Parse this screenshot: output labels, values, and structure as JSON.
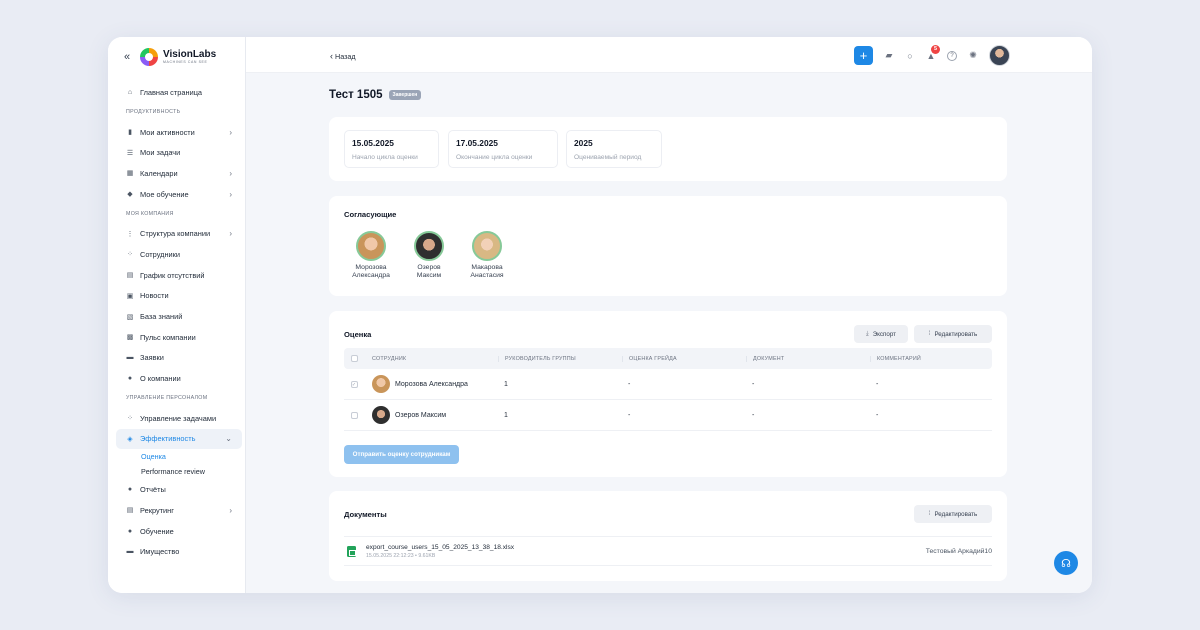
{
  "brand": {
    "name": "VisionLabs",
    "tagline": "MACHINES CAN SEE"
  },
  "colors": {
    "accent": "#1e88e5",
    "sidebar_active_bg": "#eef2f8",
    "badge": "#ef4444",
    "status_tag": "#9aa4b6"
  },
  "sidebar": {
    "home": "Главная страница",
    "sec_productivity": "ПРОДУКТИВНОСТЬ",
    "my_activities": "Мои активности",
    "my_tasks": "Мои задачи",
    "calendars": "Календари",
    "my_learning": "Мое обучение",
    "sec_company": "МОЯ КОМПАНИЯ",
    "company_structure": "Структура компании",
    "employees": "Сотрудники",
    "absence_schedule": "График отсутствий",
    "news": "Новости",
    "knowledge_base": "База знаний",
    "company_pulse": "Пульс компании",
    "requests": "Заявки",
    "about_company": "О компании",
    "sec_hr": "УПРАВЛЕНИЕ ПЕРСОНАЛОМ",
    "task_management": "Управление задачами",
    "efficiency": "Эффективность",
    "sub_assessment": "Оценка",
    "sub_performance_review": "Performance review",
    "reports": "Отчёты",
    "recruiting": "Рекрутинг",
    "training": "Обучение",
    "property": "Имущество"
  },
  "header": {
    "back_label": "Назад",
    "notifications_count": "5"
  },
  "page": {
    "title": "Тест 1505",
    "status": "Завершен"
  },
  "period": [
    {
      "value": "15.05.2025",
      "label": "Начало цикла оценки"
    },
    {
      "value": "17.05.2025",
      "label": "Окончание цикла оценки"
    },
    {
      "value": "2025",
      "label": "Оцениваемый период"
    }
  ],
  "approvers": {
    "title": "Согласующие",
    "people": [
      {
        "line1": "Морозова",
        "line2": "Александра"
      },
      {
        "line1": "Озеров",
        "line2": "Максим"
      },
      {
        "line1": "Макарова",
        "line2": "Анастасия"
      }
    ]
  },
  "assessment": {
    "title": "Оценка",
    "export_label": "Экспорт",
    "edit_label": "Редактировать",
    "columns": [
      "СОТРУДНИК",
      "РУКОВОДИТЕЛЬ ГРУППЫ",
      "ОЦЕНКА ГРЕЙДА",
      "ДОКУМЕНТ",
      "КОММЕНТАРИЙ"
    ],
    "rows": [
      {
        "employee": "Морозова Александра",
        "lead": "1",
        "grade": "-",
        "document": "-",
        "comment": "-",
        "checked": true
      },
      {
        "employee": "Озеров Максим",
        "lead": "1",
        "grade": "-",
        "document": "-",
        "comment": "-",
        "checked": false
      }
    ],
    "submit_label": "Отправить оценку сотрудникам"
  },
  "documents": {
    "title": "Документы",
    "edit_label": "Редактировать",
    "files": [
      {
        "name": "export_course_users_15_05_2025_13_38_18.xlsx",
        "date": "15.05.2025 22:12:23",
        "size": "9.61KB",
        "author": "Тестовый Аркадий10"
      }
    ]
  }
}
